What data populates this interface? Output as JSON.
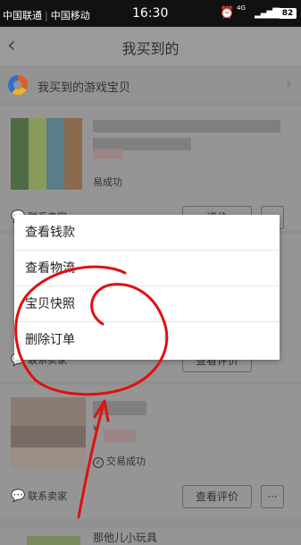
{
  "status_bar": {
    "carrier1": "中国联通",
    "carrier2": "中国移动",
    "time": "16:30",
    "network": "4G",
    "battery": "82"
  },
  "nav": {
    "title": "我买到的"
  },
  "game_section": {
    "label": "我买到的游戏宝贝"
  },
  "orders": [
    {
      "status": "易成功",
      "contact": "联系卖家",
      "button": "评价"
    },
    {
      "contact": "联系卖家",
      "button": "查看评价"
    },
    {
      "price_prefix": "¥",
      "status": "交易成功",
      "contact": "联系卖家",
      "button": "查看评价",
      "more": "···"
    },
    {
      "title": "那他儿小玩具"
    }
  ],
  "context_menu": {
    "items": [
      "查看钱款",
      "查看物流",
      "宝贝快照",
      "删除订单"
    ]
  },
  "colors": {
    "annotation": "#e01010",
    "overlay": "#8f8f8f"
  }
}
